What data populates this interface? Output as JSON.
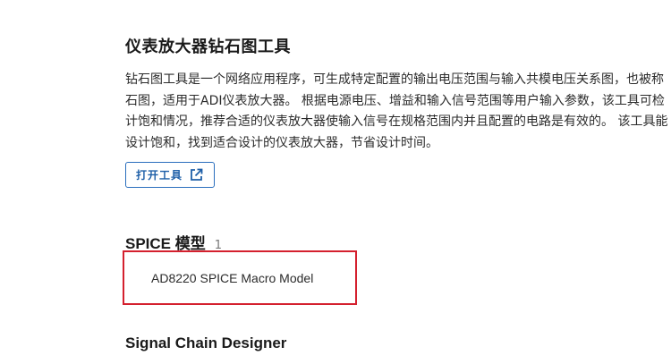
{
  "section": {
    "title": "仪表放大器钻石图工具",
    "description_lines": [
      "钻石图工具是一个网络应用程序，可生成特定配置的输出电压范围与输入共模电压关系图，也被称",
      "石图，适用于ADI仪表放大器。 根据电源电压、增益和输入信号范围等用户输入参数，该工具可检",
      "计饱和情况，推荐合适的仪表放大器使输入信号在规格范围内并且配置的电路是有效的。 该工具能",
      "设计饱和，找到适合设计的仪表放大器，节省设计时间。"
    ],
    "open_button_label": "打开工具",
    "open_button_icon": "external-link-icon",
    "accent_color": "#2a6ebd"
  },
  "spice": {
    "title": "SPICE 模型",
    "count": "1",
    "models": [
      {
        "name": "AD8220 SPICE Macro Model"
      }
    ],
    "highlight_color": "#d4202e"
  },
  "signal_chain": {
    "title": "Signal Chain Designer"
  }
}
